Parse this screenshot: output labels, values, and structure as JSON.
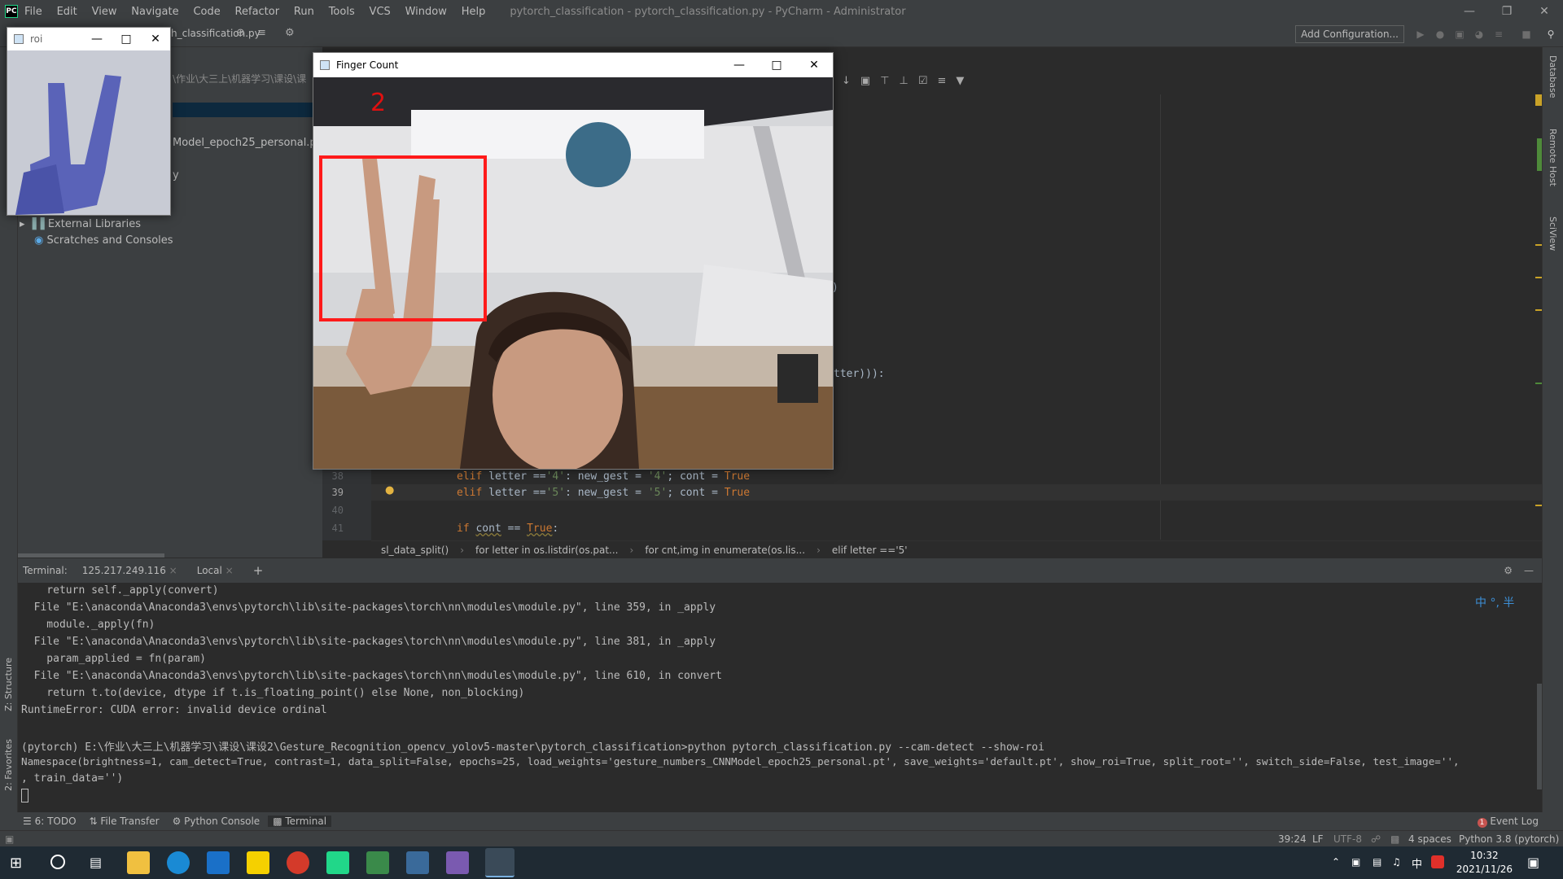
{
  "ide": {
    "menu": [
      "File",
      "Edit",
      "View",
      "Navigate",
      "Code",
      "Refactor",
      "Run",
      "Tools",
      "VCS",
      "Window",
      "Help"
    ],
    "window_title": "pytorch_classification - pytorch_classification.py - PyCharm - Administrator",
    "tab_partial": "h_classification.py",
    "add_configuration": "Add Configuration...",
    "logo": "PC"
  },
  "project": {
    "path_partial": "\\作业\\大三上\\机器学习\\课设\\课",
    "file_partial": "Model_epoch25_personal.pt",
    "item_partial": "y",
    "external_libraries": "External Libraries",
    "scratches": "Scratches and Consoles"
  },
  "editor": {
    "frag1": ")",
    "frag2": "tter))):",
    "lines": [
      {
        "no": "38",
        "kw": "elif",
        "name": "letter",
        "op": " ==",
        "lit": "'4'",
        "rest": ": new_gest = ",
        "lit2": "'4'",
        "tail": "; cont = ",
        "bool": "True"
      },
      {
        "no": "39",
        "kw": "elif",
        "name": "letter",
        "op": " ==",
        "lit": "'5'",
        "rest": ": new_gest = ",
        "lit2": "'5'",
        "tail": "; cont = ",
        "bool": "True"
      },
      {
        "no": "40"
      },
      {
        "no": "41",
        "kw": "if",
        "name": "cont",
        "op": " == ",
        "bool": "True",
        "end": ":"
      }
    ],
    "breadcrumb": [
      "sl_data_split()",
      "for letter in os.listdir(os.pat...",
      "for cnt,img in enumerate(os.lis...",
      "elif letter =='5'"
    ]
  },
  "terminal": {
    "label": "Terminal:",
    "tabs": [
      "125.217.249.116",
      "Local"
    ],
    "add": "+",
    "lines": [
      "    return self._apply(convert)",
      "  File \"E:\\anaconda\\Anaconda3\\envs\\pytorch\\lib\\site-packages\\torch\\nn\\modules\\module.py\", line 359, in _apply",
      "    module._apply(fn)",
      "  File \"E:\\anaconda\\Anaconda3\\envs\\pytorch\\lib\\site-packages\\torch\\nn\\modules\\module.py\", line 381, in _apply",
      "    param_applied = fn(param)",
      "  File \"E:\\anaconda\\Anaconda3\\envs\\pytorch\\lib\\site-packages\\torch\\nn\\modules\\module.py\", line 610, in convert",
      "    return t.to(device, dtype if t.is_floating_point() else None, non_blocking)",
      "RuntimeError: CUDA error: invalid device ordinal",
      "",
      "(pytorch) E:\\作业\\大三上\\机器学习\\课设\\课设2\\Gesture_Recognition_opencv_yolov5-master\\pytorch_classification>python pytorch_classification.py --cam-detect --show-roi",
      "Namespace(brightness=1, cam_detect=True, contrast=1, data_split=False, epochs=25, load_weights='gesture_numbers_CNNModel_epoch25_personal.pt', save_weights='default.pt', show_roi=True, split_root='', switch_side=False, test_image='',",
      ", train_data='')"
    ],
    "ime": "中 °, 半"
  },
  "toolwindows": [
    "6: TODO",
    "File Transfer",
    "Python Console",
    "Terminal"
  ],
  "left_labels": [
    "Z: Structure",
    "2: Favorites"
  ],
  "right_labels": [
    "Database",
    "Remote Host",
    "SciView"
  ],
  "status": {
    "event_log": "Event Log",
    "event_count": "1",
    "position": "39:24",
    "line_sep": "LF",
    "encoding": "UTF-8",
    "indent": "4 spaces",
    "interpreter": "Python 3.8 (pytorch)"
  },
  "roi_window": {
    "title": "roi"
  },
  "finger_window": {
    "title": "Finger Count",
    "count": "2"
  },
  "taskbar": {
    "time": "10:32",
    "date": "2021/11/26",
    "ime": "中"
  }
}
